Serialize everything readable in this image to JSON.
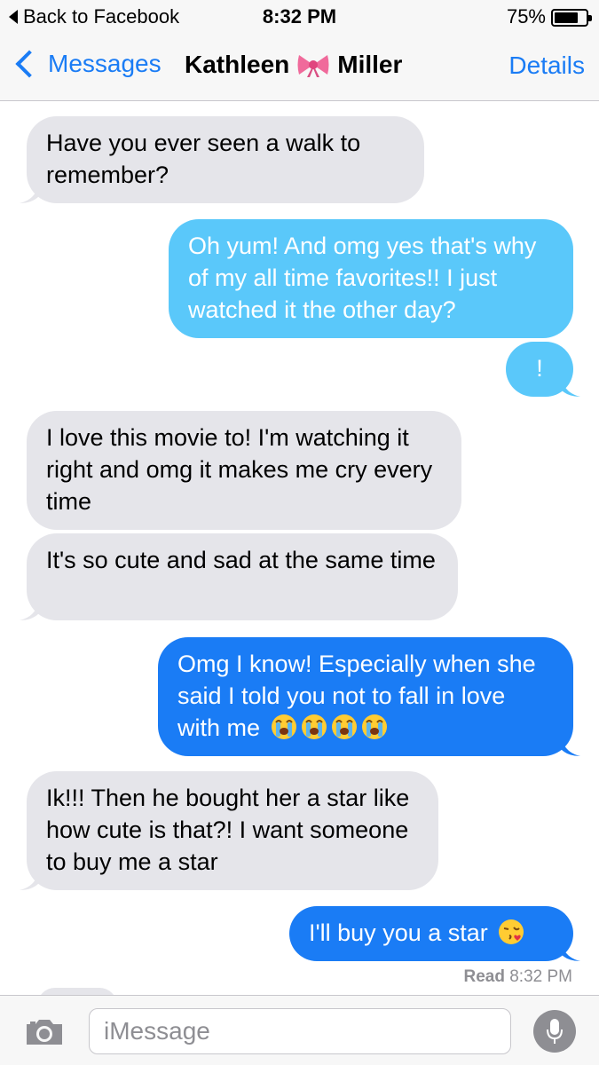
{
  "status_bar": {
    "back_to_app": "Back to Facebook",
    "time": "8:32 PM",
    "battery_percent_text": "75%",
    "battery_level": 0.75
  },
  "nav": {
    "back_label": "Messages",
    "contact_first": "Kathleen",
    "contact_emoji": "ribbon-bow",
    "contact_last": "Miller",
    "details_label": "Details"
  },
  "messages": [
    {
      "from": "them",
      "text": "Have you ever seen a walk to remember?"
    },
    {
      "from": "me",
      "style": "light",
      "text": "Oh yum! And omg yes that's why of my all time favorites!! I just watched it the other day?"
    },
    {
      "from": "me",
      "style": "light",
      "text": "!"
    },
    {
      "from": "them",
      "text": "I love this movie to! I'm watching it right and omg it makes me cry every time"
    },
    {
      "from": "them",
      "text": "It's so cute and sad at the same time"
    },
    {
      "from": "me",
      "style": "normal",
      "text": "Omg I know! Especially when she said I told you not to fall in love with me",
      "emojis": [
        "loudly-crying-face",
        "loudly-crying-face",
        "loudly-crying-face",
        "loudly-crying-face"
      ]
    },
    {
      "from": "them",
      "text": "Ik!!! Then he bought her a star like how cute is that?! I want someone to buy me a star"
    },
    {
      "from": "me",
      "style": "normal",
      "text": "I'll buy you a star",
      "emojis": [
        "face-blowing-a-kiss"
      ]
    }
  ],
  "read_receipt": {
    "label": "Read",
    "time": "8:32 PM"
  },
  "input": {
    "placeholder": "iMessage"
  },
  "colors": {
    "accent": "#1a7cf5",
    "bubble_in": "#e5e5ea",
    "bubble_out": "#1a7cf5",
    "bubble_out_light": "#5ac8fa"
  }
}
